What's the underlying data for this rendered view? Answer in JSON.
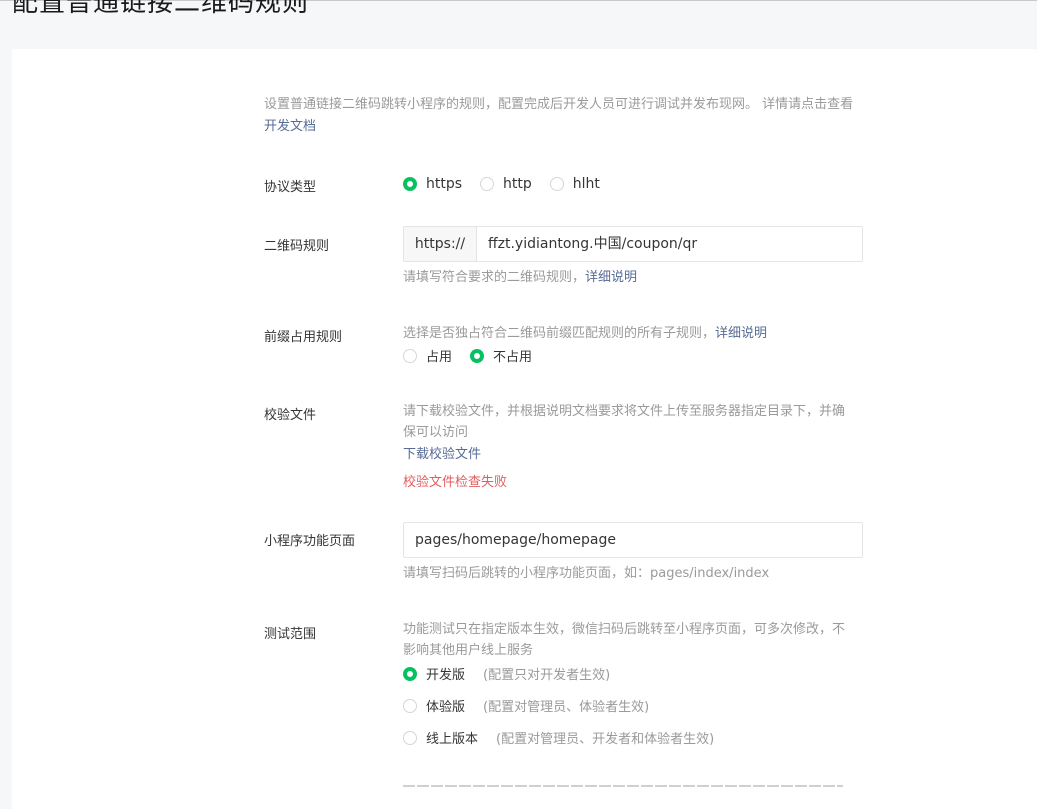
{
  "page": {
    "title": "配置普通链接二维码规则"
  },
  "intro": {
    "text": "设置普通链接二维码跳转小程序的规则，配置完成后开发人员可进行调试并发布现网。 详情请点击查看",
    "link": "开发文档"
  },
  "protocol": {
    "label": "协议类型",
    "options": [
      {
        "label": "https",
        "checked": true
      },
      {
        "label": "http",
        "checked": false
      },
      {
        "label": "hlht",
        "checked": false
      }
    ]
  },
  "qr_rule": {
    "label": "二维码规则",
    "prefix": "https://",
    "value": "ffzt.yidiantong.中国/coupon/qr",
    "hint": "请填写符合要求的二维码规则，",
    "hint_link": "详细说明"
  },
  "prefix_rule": {
    "label": "前缀占用规则",
    "hint": "选择是否独占符合二维码前缀匹配规则的所有子规则，",
    "hint_link": "详细说明",
    "options": [
      {
        "label": "占用",
        "checked": false
      },
      {
        "label": "不占用",
        "checked": true
      }
    ]
  },
  "verify_file": {
    "label": "校验文件",
    "hint": "请下载校验文件，并根据说明文档要求将文件上传至服务器指定目录下，并确保可以访问",
    "download_link": "下载校验文件",
    "error": "校验文件检查失败"
  },
  "mini_page": {
    "label": "小程序功能页面",
    "value": "pages/homepage/homepage",
    "hint": "请填写扫码后跳转的小程序功能页面，如：pages/index/index"
  },
  "test_scope": {
    "label": "测试范围",
    "hint": "功能测试只在指定版本生效，微信扫码后跳转至小程序页面，可多次修改，不影响其他用户线上服务",
    "options": [
      {
        "label": "开发版",
        "note": "(配置只对开发者生效)",
        "checked": true
      },
      {
        "label": "体验版",
        "note": "(配置对管理员、体验者生效)",
        "checked": false
      },
      {
        "label": "线上版本",
        "note": "(配置对管理员、开发者和体验者生效)",
        "checked": false
      }
    ]
  }
}
